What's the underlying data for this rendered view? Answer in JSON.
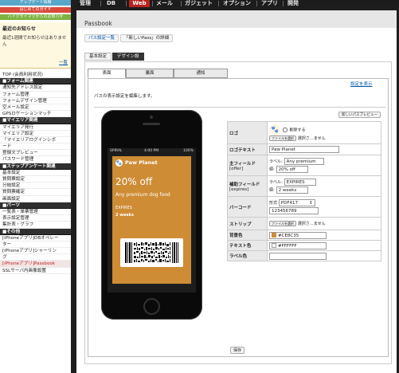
{
  "nav": {
    "items": [
      "管理",
      "DB",
      "Web",
      "メール",
      "ガジェット",
      "オプション",
      "アプリ",
      "開発"
    ],
    "active": "Web"
  },
  "sidebar": {
    "top_buttons": [
      "アップデート情報",
      "はじめてのガイド",
      "ハイクセイマクからのお知らせ"
    ],
    "notice": {
      "title": "最近のお知らせ",
      "text": "最近1週間でお知らせはありません",
      "link": "一覧"
    },
    "menu": [
      {
        "label": "TOP (会員利用状況)",
        "type": "item"
      },
      {
        "label": "■フォーム関連",
        "type": "header"
      },
      {
        "label": "通知先アドレス設定",
        "type": "item"
      },
      {
        "label": "フォーム管理",
        "type": "item"
      },
      {
        "label": "フォームデザイン管理",
        "type": "item"
      },
      {
        "label": "空メール設定",
        "type": "item"
      },
      {
        "label": "GPSロケーションマッチ",
        "type": "item"
      },
      {
        "label": "■マイエリア関連",
        "type": "header"
      },
      {
        "label": "マイエリア発行",
        "type": "item"
      },
      {
        "label": "マイエリア設定",
        "type": "item"
      },
      {
        "label": "「マイエリアログインシボ",
        "type": "item"
      },
      {
        "label": "ード",
        "type": "item"
      },
      {
        "label": "登録文プレビュー",
        "type": "item"
      },
      {
        "label": "パスワード管理",
        "type": "item"
      },
      {
        "label": "■ステップアンケート関連",
        "type": "header"
      },
      {
        "label": "基本設定",
        "type": "item"
      },
      {
        "label": "質問票設定",
        "type": "item"
      },
      {
        "label": "分岐設定",
        "type": "item"
      },
      {
        "label": "質問票確定",
        "type": "item"
      },
      {
        "label": "画面設定",
        "type": "item"
      },
      {
        "label": "■パーツ",
        "type": "header"
      },
      {
        "label": "一覧表・単票管理",
        "type": "item"
      },
      {
        "label": "表示設定管理",
        "type": "item"
      },
      {
        "label": "集計表・グラフ",
        "type": "item"
      },
      {
        "label": "■その他",
        "type": "header"
      },
      {
        "label": "[iPhoneアプリ]DBオペレー",
        "type": "item"
      },
      {
        "label": "ター",
        "type": "item"
      },
      {
        "label": "[iPhoneアプリ]シャーリン",
        "type": "item"
      },
      {
        "label": "グ",
        "type": "item"
      },
      {
        "label": "[iPhoneアプリ]Passbook",
        "type": "active"
      },
      {
        "label": "SSLサーバ内画像設置",
        "type": "item"
      }
    ]
  },
  "main": {
    "title": "Passbook",
    "breadcrumb": [
      "パス設定一覧",
      "「新しいPass」の詳細"
    ],
    "tabs": [
      "基本設定",
      "デザイン設"
    ],
    "active_tab": "デザイン設",
    "subtabs": [
      "表面",
      "裏面",
      "通知"
    ],
    "active_subtab": "表面",
    "advanced_link": "設定を表示",
    "description": "パスの表示設定を編集します。",
    "preview_button": "新しいパスプレビュー",
    "save_button": "保存"
  },
  "phone": {
    "carrier": "SPIRAL",
    "time": "4:00 PM",
    "battery": "100%"
  },
  "pass": {
    "logo_text": "Paw Planet",
    "primary_value": "20% off",
    "primary_label": "Any premium dog food",
    "aux_label": "EXPIRES",
    "aux_value": "2 weeks",
    "background_color": "#CE8C35"
  },
  "form": {
    "logo": {
      "label": "ロゴ",
      "delete": "削除する",
      "file_button": "ファイルを選択",
      "file_status": "選択さ…ません"
    },
    "logo_text": {
      "label": "ロゴテキスト",
      "value": "Paw Planet"
    },
    "primary_field": {
      "label": "主フィールド",
      "key": "[offer]",
      "label_caption": "ラベル",
      "label_value": "Any premium",
      "value_caption": "値",
      "value": "20% off"
    },
    "aux_field": {
      "label": "補助フィールド",
      "key": "[expires]",
      "label_caption": "ラベル",
      "label_value": "EXPIRES",
      "value_caption": "値",
      "value": "2 weeks"
    },
    "barcode": {
      "label": "バーコード",
      "format_caption": "形式",
      "format": "PDF417",
      "message": "123456789"
    },
    "strip": {
      "label": "ストリップ",
      "file_button": "ファイルを選択",
      "file_status": "選択さ…ません"
    },
    "bg_color": {
      "label": "背景色",
      "value": "#CE8C35"
    },
    "text_color": {
      "label": "テキスト色",
      "value": "#FFFFFF"
    },
    "label_color": {
      "label": "ラベル色",
      "value": ""
    }
  }
}
